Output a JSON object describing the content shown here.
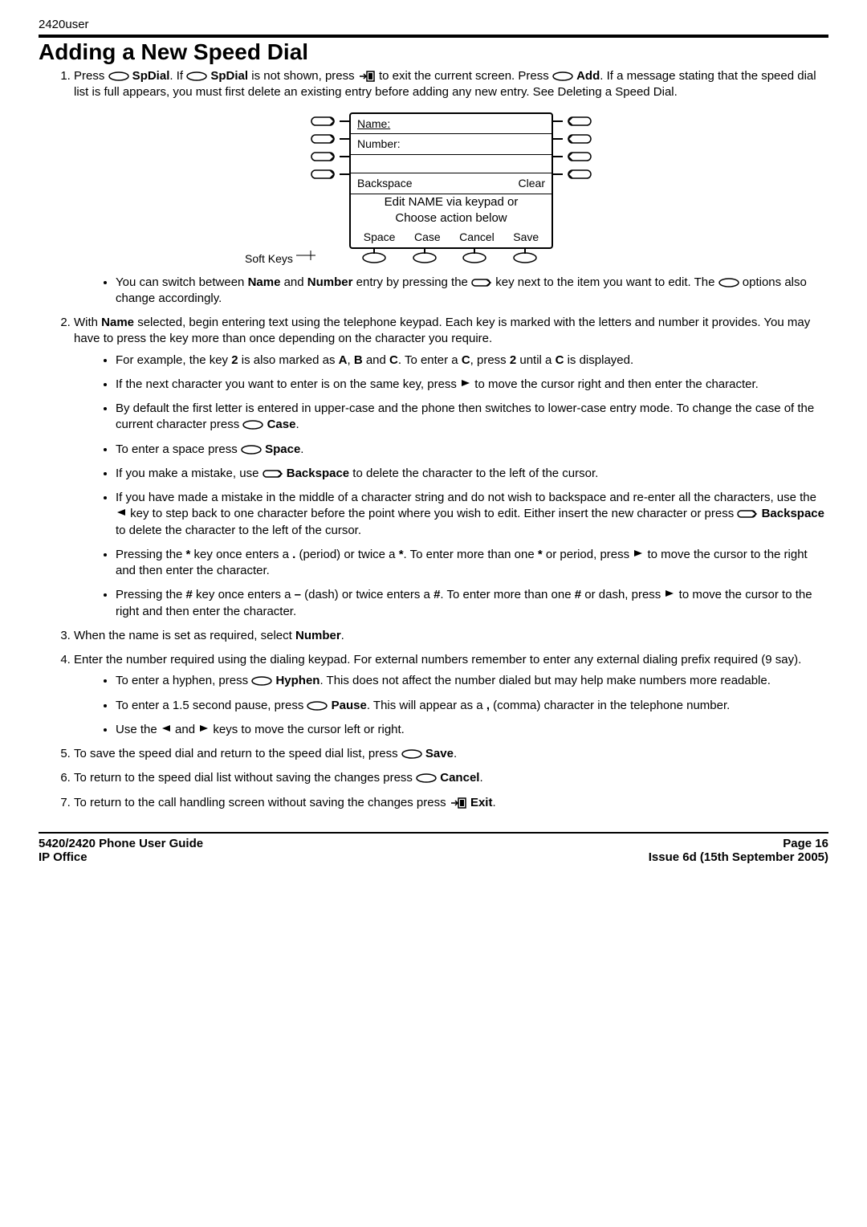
{
  "doc_header": "2420user",
  "title": "Adding a New Speed Dial",
  "step1": {
    "pre": "Press ",
    "spdial1": " SpDial",
    "mid1": ". If ",
    "spdial2": " SpDial",
    "mid2": " is not shown, press ",
    "mid3": " to exit the current screen. Press ",
    "add": "Add",
    "rest": ". If a message stating that the speed dial list is full appears, you must first delete an existing entry before adding any new entry. See Deleting a Speed Dial."
  },
  "figure": {
    "name_label": "Name:",
    "number_label": "Number:",
    "backspace": "Backspace",
    "clear": "Clear",
    "meta1": "Edit NAME via keypad or",
    "meta2": "Choose action below",
    "soft": [
      "Space",
      "Case",
      "Cancel",
      "Save"
    ],
    "softkeys_label": "Soft Keys"
  },
  "step1_bullet": {
    "p1": "You can switch between ",
    "name": "Name",
    "and": " and ",
    "number": "Number",
    "p2": " entry by pressing the ",
    "p3": " key next to the item you want to edit. The ",
    "p4": " options also change accordingly."
  },
  "step2": {
    "pre": "With ",
    "name": "Name",
    "rest": " selected, begin entering text using the telephone keypad. Each key is marked with the letters and number it provides. You may have to press the key more than once depending on the character you require."
  },
  "step2_bullets": {
    "b1_a": "For example, the key ",
    "b1_2": "2",
    "b1_b": " is also marked as ",
    "b1_A": "A",
    "b1_c": ", ",
    "b1_B": "B",
    "b1_d": " and ",
    "b1_C": "C",
    "b1_e": ". To enter a ",
    "b1_C2": "C",
    "b1_f": ", press ",
    "b1_22": "2",
    "b1_g": " until a ",
    "b1_C3": "C",
    "b1_h": " is displayed.",
    "b2_a": "If the next character you want to enter is on the same key, press ",
    "b2_b": " to move the cursor right and then enter the character.",
    "b3_a": "By default the first letter is entered in upper-case and the phone then switches to lower-case entry mode. To change the case of the current character press ",
    "b3_case": " Case",
    "b3_b": ".",
    "b4_a": "To enter a space press ",
    "b4_space": " Space",
    "b4_b": ".",
    "b5_a": "If you make a mistake, use ",
    "b5_bksp": " Backspace",
    "b5_b": " to delete the character to the left of the cursor.",
    "b6_a": "If you have made a mistake in the middle of a character string and do not wish to backspace and re-enter all the characters, use the ",
    "b6_b": " key to step back to one character before the point where you wish to edit. Either insert the new character or press ",
    "b6_bksp": "Backspace",
    "b6_c": " to delete the character to the left of the cursor.",
    "b7_a": "Pressing the ",
    "b7_star": "*",
    "b7_b": " key once enters a ",
    "b7_period": ".",
    "b7_c": " (period) or twice a ",
    "b7_star2": "*",
    "b7_d": ". To enter more than one ",
    "b7_star3": "*",
    "b7_e": " or period, press ",
    "b7_f": " to move the cursor to the right and then enter the character.",
    "b8_a": "Pressing the ",
    "b8_hash": "#",
    "b8_b": " key once enters a ",
    "b8_dash": "–",
    "b8_c": " (dash) or twice enters a ",
    "b8_hash2": "#",
    "b8_d": ". To enter more than one ",
    "b8_hash3": "#",
    "b8_e": " or dash, press ",
    "b8_f": " to move the cursor to the right and then enter the character."
  },
  "step3": {
    "pre": "When the name is set as required, select ",
    "number": "Number",
    "post": "."
  },
  "step4": {
    "text": "Enter the number required using the dialing keypad. For external numbers remember to enter any external dialing prefix required (9 say)."
  },
  "step4_bullets": {
    "b1_a": "To enter a hyphen, press ",
    "b1_hyphen": " Hyphen",
    "b1_b": ". This does not affect the number dialed but may help make numbers more readable.",
    "b2_a": "To enter a 1.5 second pause, press ",
    "b2_pause": " Pause",
    "b2_b": ". This will appear as a ",
    "b2_comma": ",",
    "b2_c": " (comma) character in the telephone number.",
    "b3_a": "Use the ",
    "b3_b": " and ",
    "b3_c": " keys to move the cursor left or right."
  },
  "step5": {
    "pre": "To save the speed dial and return to the speed dial list, press ",
    "save": " Save",
    "post": "."
  },
  "step6": {
    "pre": "To return to the speed dial list without saving the changes press ",
    "cancel": " Cancel",
    "post": "."
  },
  "step7": {
    "pre": "To return to the call handling screen without saving the changes press ",
    "exit": " Exit",
    "post": "."
  },
  "footer": {
    "left1": "5420/2420 Phone User Guide",
    "left2": "IP Office",
    "right1": "Page 16",
    "right2": "Issue 6d (15th September 2005)"
  }
}
